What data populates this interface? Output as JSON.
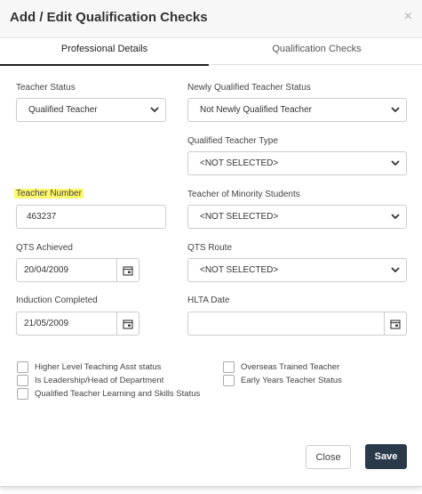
{
  "dialog": {
    "title": "Add / Edit Qualification Checks",
    "close_glyph": "×"
  },
  "tabs": [
    {
      "label": "Professional Details",
      "active": true
    },
    {
      "label": "Qualification Checks",
      "active": false
    }
  ],
  "fields": {
    "teacher_status": {
      "label": "Teacher Status",
      "value": "Qualified Teacher"
    },
    "nqt_status": {
      "label": "Newly Qualified Teacher Status",
      "value": "Not Newly Qualified Teacher"
    },
    "qualified_teacher_type": {
      "label": "Qualified Teacher Type",
      "value": "<NOT SELECTED>"
    },
    "teacher_number": {
      "label": "Teacher Number",
      "value": "463237",
      "highlight_color": "#fdf86b"
    },
    "teacher_minority": {
      "label": "Teacher of Minority Students",
      "value": "<NOT SELECTED>"
    },
    "qts_achieved": {
      "label": "QTS Achieved",
      "value": "20/04/2009"
    },
    "qts_route": {
      "label": "QTS Route",
      "value": "<NOT SELECTED>"
    },
    "induction_completed": {
      "label": "Induction Completed",
      "value": "21/05/2009"
    },
    "hlta_date": {
      "label": "HLTA Date",
      "value": ""
    }
  },
  "checkboxes": {
    "hlta_status": {
      "label": "Higher Level Teaching Asst status",
      "checked": false
    },
    "leadership": {
      "label": "Is Leadership/Head of Department",
      "checked": false
    },
    "qtls_status": {
      "label": "Qualified Teacher Learning and Skills Status",
      "checked": false
    },
    "overseas": {
      "label": "Overseas Trained Teacher",
      "checked": false
    },
    "early_years": {
      "label": "Early Years Teacher Status",
      "checked": false
    }
  },
  "buttons": {
    "close": "Close",
    "save": "Save"
  },
  "colors": {
    "save_bg": "#2b3a4a",
    "highlight": "#fdf86b"
  }
}
